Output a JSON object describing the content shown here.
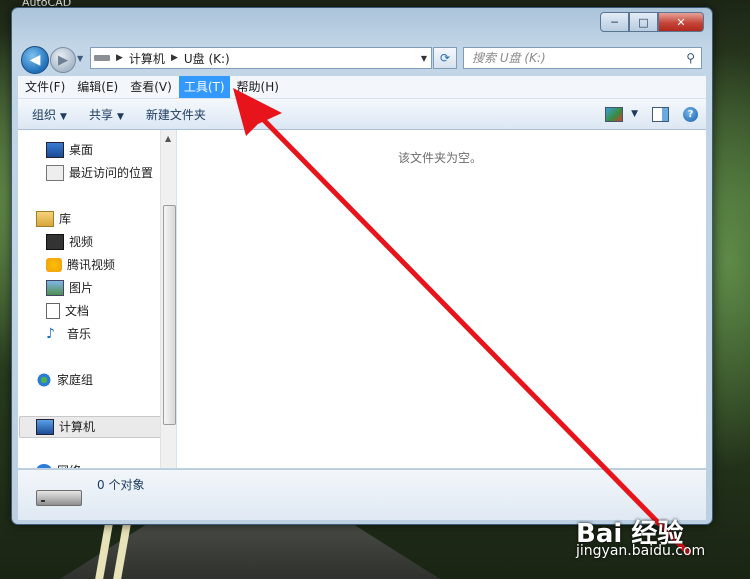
{
  "desktop": {
    "label": "AutoCAD"
  },
  "window": {
    "controls": {
      "minimize": "─",
      "maximize": "□",
      "close": "✕"
    }
  },
  "navigation": {
    "back_glyph": "◀",
    "forward_glyph": "▶"
  },
  "address": {
    "segments": [
      "计算机",
      "U盘 (K:)"
    ],
    "separator": "▶"
  },
  "search": {
    "placeholder": "搜索 U盘 (K:)"
  },
  "menubar": {
    "items": [
      "文件(F)",
      "编辑(E)",
      "查看(V)",
      "工具(T)",
      "帮助(H)"
    ],
    "active_index": 3
  },
  "toolbar": {
    "organize": "组织",
    "share": "共享",
    "new_folder": "新建文件夹",
    "help": "?"
  },
  "sidebar": {
    "items": [
      {
        "label": "桌面",
        "icon": "desktop-icon"
      },
      {
        "label": "最近访问的位置",
        "icon": "recent-places-icon"
      },
      {
        "label": "库",
        "icon": "library-icon"
      },
      {
        "label": "视频",
        "icon": "video-icon"
      },
      {
        "label": "腾讯视频",
        "icon": "tencent-video-icon"
      },
      {
        "label": "图片",
        "icon": "pictures-icon"
      },
      {
        "label": "文档",
        "icon": "documents-icon"
      },
      {
        "label": "音乐",
        "icon": "music-icon"
      },
      {
        "label": "家庭组",
        "icon": "homegroup-icon"
      },
      {
        "label": "计算机",
        "icon": "computer-icon"
      },
      {
        "label": "网络",
        "icon": "network-icon"
      }
    ],
    "selected": "计算机"
  },
  "content": {
    "empty_message": "该文件夹为空。"
  },
  "details": {
    "item_count": "0 个对象"
  },
  "watermark": {
    "brand": "Bai 经验",
    "url": "jingyan.baidu.com"
  },
  "colors": {
    "menu_highlight": "#3399ff",
    "annotation_arrow": "#e8141b"
  }
}
